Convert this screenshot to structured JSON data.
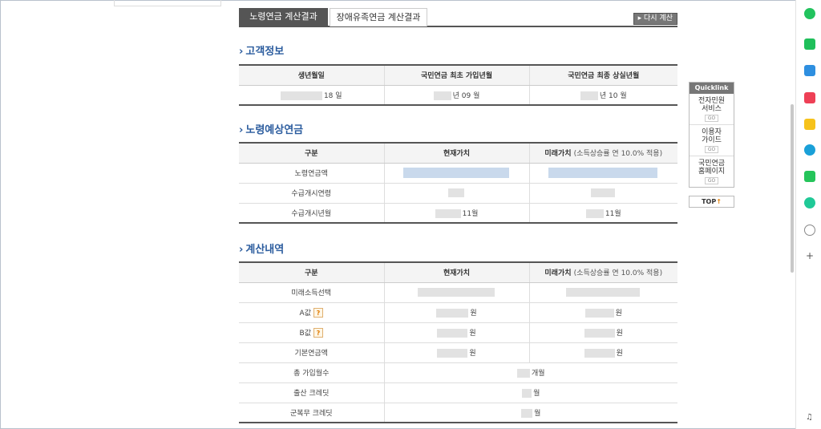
{
  "tabs": {
    "active": "노령연금 계산결과",
    "inactive": "장애유족연금 계산결과",
    "recalc": "▸ 다시 계산"
  },
  "customer": {
    "title": "고객정보",
    "headers": [
      "생년월일",
      "국민연금 최초 가입년월",
      "국민연금 최종 상실년월"
    ],
    "row": [
      "18 일",
      "년 09 월",
      "년 10 월"
    ]
  },
  "pension": {
    "title": "노령예상연금",
    "headers": [
      "구분",
      "현재가치",
      "미래가치"
    ],
    "future_note": "(소득상승률 연 10.0% 적용)",
    "rows": [
      {
        "label": "노령연금액",
        "current": "",
        "future": ""
      },
      {
        "label": "수급개시연령",
        "current": "",
        "future": ""
      },
      {
        "label": "수급개시년월",
        "current": "11월",
        "future": "11월"
      }
    ]
  },
  "calc": {
    "title": "계산내역",
    "headers": [
      "구분",
      "현재가치",
      "미래가치"
    ],
    "future_note": "(소득상승률 연 10.0% 적용)",
    "rows": [
      {
        "label": "미래소득선택",
        "current": "",
        "future": ""
      },
      {
        "label": "A값",
        "help": "?",
        "current": "원",
        "future": "원"
      },
      {
        "label": "B값",
        "help": "?",
        "current": "원",
        "future": "원"
      },
      {
        "label": "기본연금액",
        "current": "원",
        "future": "원"
      },
      {
        "label": "총 가입월수",
        "merged": "개월"
      },
      {
        "label": "출산 크레딧",
        "merged": "월"
      },
      {
        "label": "군복무 크레딧",
        "merged": "월"
      }
    ]
  },
  "quicklink": {
    "title": "Quicklink",
    "items": [
      {
        "label1": "전자민원",
        "label2": "서비스",
        "go": "GO"
      },
      {
        "label1": "이용자",
        "label2": "가이드",
        "go": "GO"
      },
      {
        "label1": "국민연금",
        "label2": "홈페이지",
        "go": "GO"
      }
    ],
    "top": "TOP",
    "top_arrow": "↑"
  },
  "sidebar_icons": [
    {
      "name": "green-circle-icon",
      "color": "#22c35e"
    },
    {
      "name": "green-chat-icon",
      "color": "#1fbf5a"
    },
    {
      "name": "mail-icon",
      "color": "#2e8fe0"
    },
    {
      "name": "pocket-icon",
      "color": "#ee4056"
    },
    {
      "name": "star-icon",
      "color": "#f6c21b"
    },
    {
      "name": "edge-icon",
      "color": "#1aa0d8"
    },
    {
      "name": "green-square-icon",
      "color": "#25c45a"
    },
    {
      "name": "play-icon",
      "color": "#20c997"
    },
    {
      "name": "face-icon",
      "color": "#888888"
    }
  ]
}
